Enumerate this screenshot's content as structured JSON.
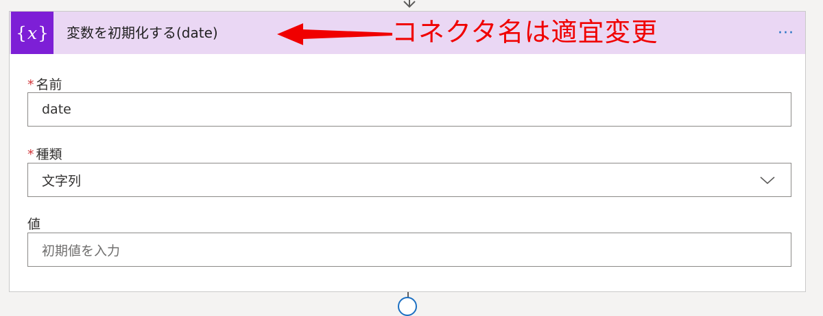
{
  "action_card": {
    "icon_label": "{x}",
    "icon_name": "variable-icon",
    "title": "変数を初期化する(date)",
    "more_label": "···",
    "header_color": "#ead7f4",
    "icon_color": "#7d1fd6"
  },
  "annotation": {
    "text": "コネクタ名は適宜変更",
    "color": "#f00000"
  },
  "fields": {
    "name": {
      "label": "名前",
      "required": "*",
      "value": "date"
    },
    "type": {
      "label": "種類",
      "required": "*",
      "value": "文字列"
    },
    "value": {
      "label": "値",
      "placeholder": "初期値を入力"
    }
  }
}
